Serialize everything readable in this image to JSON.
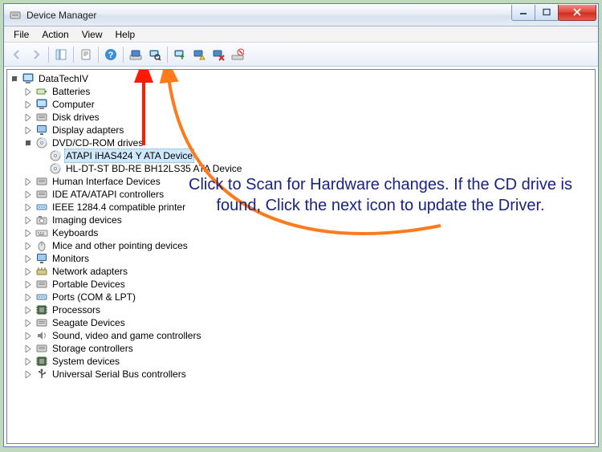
{
  "window": {
    "title": "Device Manager"
  },
  "menu": {
    "file": "File",
    "action": "Action",
    "view": "View",
    "help": "Help"
  },
  "toolbar": {
    "back": "Back",
    "forward": "Forward",
    "show_hide_tree": "Show/Hide Console Tree",
    "properties": "Properties",
    "help": "Help",
    "show_hidden": "Show hidden devices",
    "scan": "Scan for hardware changes",
    "update": "Update Driver Software",
    "uninstall": "Uninstall",
    "disable": "Disable"
  },
  "tree": {
    "root": "DataTechIV",
    "items": [
      "Batteries",
      "Computer",
      "Disk drives",
      "Display adapters",
      "DVD/CD-ROM drives",
      "Human Interface Devices",
      "IDE ATA/ATAPI controllers",
      "IEEE 1284.4 compatible printer",
      "Imaging devices",
      "Keyboards",
      "Mice and other pointing devices",
      "Monitors",
      "Network adapters",
      "Portable Devices",
      "Ports (COM & LPT)",
      "Processors",
      "Seagate Devices",
      "Sound, video and game controllers",
      "Storage controllers",
      "System devices",
      "Universal Serial Bus controllers"
    ],
    "dvd_children": [
      "ATAPI iHAS424   Y ATA Device",
      "HL-DT-ST BD-RE  BH12LS35 ATA Device"
    ]
  },
  "annotation": {
    "text": "Click to Scan for Hardware changes. If the CD drive is found, Click the next icon to update the Driver."
  }
}
